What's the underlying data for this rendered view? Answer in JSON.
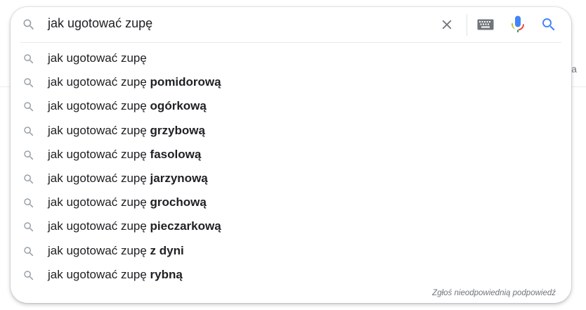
{
  "background": {
    "partial_text": "ia"
  },
  "search": {
    "query": "jak ugotować zupę",
    "clear_icon": "close-icon",
    "keyboard_icon": "keyboard-icon",
    "mic_icon": "microphone-icon",
    "search_icon": "search-icon"
  },
  "suggestions": [
    {
      "prefix": "jak ugotować zupę",
      "suffix": ""
    },
    {
      "prefix": "jak ugotować zupę ",
      "suffix": "pomidorową"
    },
    {
      "prefix": "jak ugotować zupę ",
      "suffix": "ogórkową"
    },
    {
      "prefix": "jak ugotować zupę ",
      "suffix": "grzybową"
    },
    {
      "prefix": "jak ugotować zupę ",
      "suffix": "fasolową"
    },
    {
      "prefix": "jak ugotować zupę ",
      "suffix": "jarzynową"
    },
    {
      "prefix": "jak ugotować zupę ",
      "suffix": "grochową"
    },
    {
      "prefix": "jak ugotować zupę ",
      "suffix": "pieczarkową"
    },
    {
      "prefix": "jak ugotować zupę ",
      "suffix": "z dyni"
    },
    {
      "prefix": "jak ugotować zupę ",
      "suffix": "rybną"
    }
  ],
  "footer": {
    "report_label": "Zgłoś nieodpowiednią podpowiedź"
  },
  "colors": {
    "google_blue": "#4285f4",
    "google_red": "#ea4335",
    "google_yellow": "#fbbc05",
    "google_green": "#34a853",
    "icon_gray": "#9aa0a6",
    "text": "#202124"
  }
}
